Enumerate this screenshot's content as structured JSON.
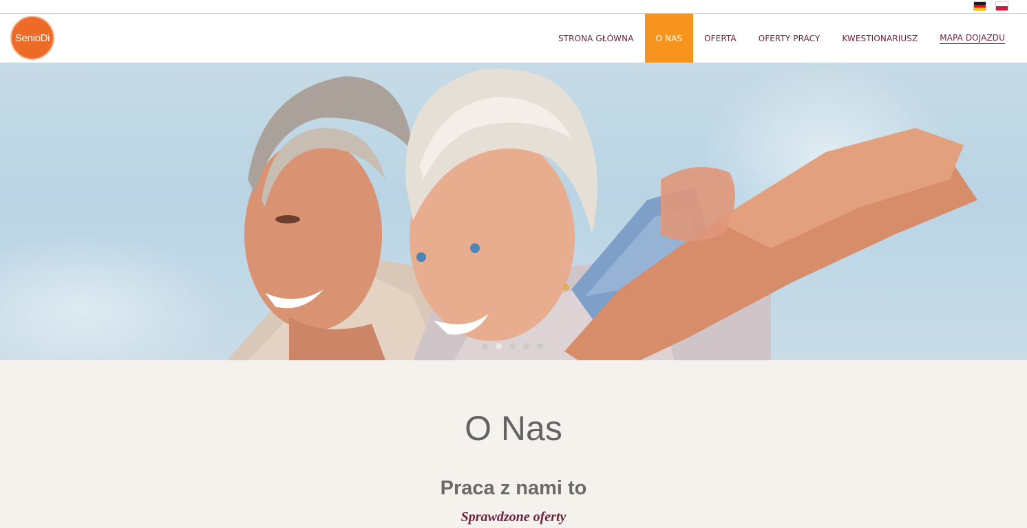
{
  "brand": {
    "logo_text": "SenioDi",
    "logo_color": "#ee6a27"
  },
  "languages": [
    {
      "code": "de",
      "icon": "german-flag-icon"
    },
    {
      "code": "pl",
      "icon": "polish-flag-icon"
    }
  ],
  "nav": {
    "items": [
      {
        "label": "STRONA GŁÓWNA",
        "active": false
      },
      {
        "label": "O NAS",
        "active": true
      },
      {
        "label": "OFERTA",
        "active": false
      },
      {
        "label": "OFERTY PRACY",
        "active": false
      },
      {
        "label": "KWESTIONARIUSZ",
        "active": false
      },
      {
        "label": "MAPA DOJAZDU",
        "active": false
      }
    ],
    "active_color": "#f7941d",
    "text_color": "#6e2240"
  },
  "slider": {
    "slide_count": 5,
    "active_index": 1
  },
  "content": {
    "title": "O Nas",
    "subtitle": "Praca z nami to",
    "tagline": "Sprawdzone oferty"
  }
}
